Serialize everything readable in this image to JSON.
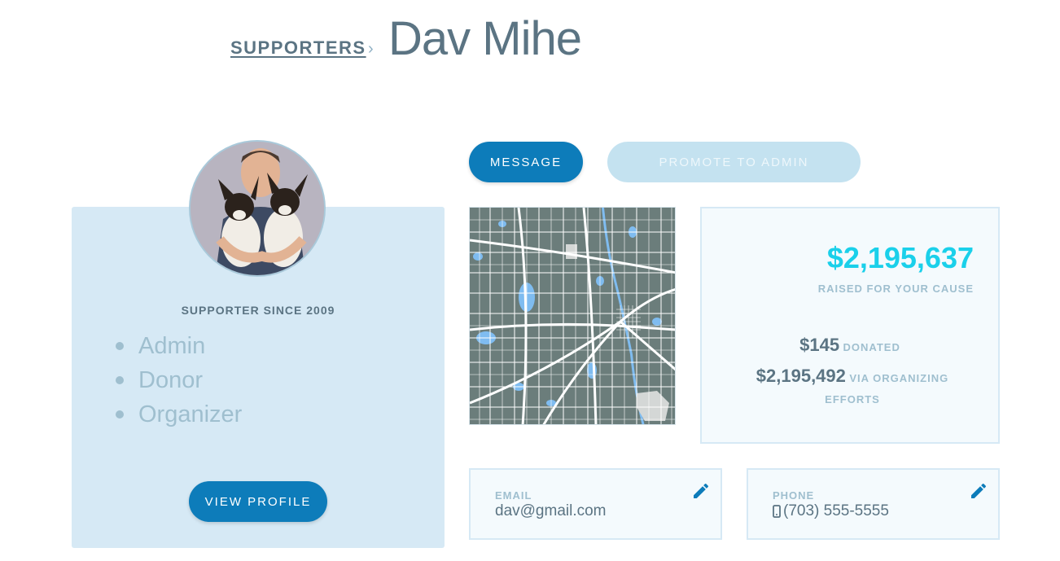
{
  "header": {
    "breadcrumb": "SUPPORTERS",
    "chevron": "›",
    "title": "Dav Mihe"
  },
  "profile": {
    "avatar_alt": "avatar",
    "since": "SUPPORTER SINCE 2009",
    "roles": [
      "Admin",
      "Donor",
      "Organizer"
    ],
    "view_profile": "VIEW PROFILE"
  },
  "actions": {
    "message": "MESSAGE",
    "promote": "PROMOTE TO ADMIN"
  },
  "stats": {
    "raised_value": "$2,195,637",
    "raised_label": "RAISED FOR YOUR CAUSE",
    "donated_value": "$145",
    "donated_label": "DONATED",
    "organizing_value": "$2,195,492",
    "organizing_label": "VIA ORGANIZING EFFORTS"
  },
  "contact": {
    "email_label": "EMAIL",
    "email_value": "dav@gmail.com",
    "phone_label": "PHONE",
    "phone_value": "(703) 555-5555"
  },
  "colors": {
    "primary": "#0d7cba",
    "accent": "#1ad0ea",
    "card_bg": "#d6e9f5",
    "map_land": "#6b7d7b",
    "map_water": "#7fbcf0"
  },
  "icons": {
    "chevron": "chevron-right-icon",
    "edit": "pencil-icon",
    "phone": "mobile-phone-icon"
  }
}
